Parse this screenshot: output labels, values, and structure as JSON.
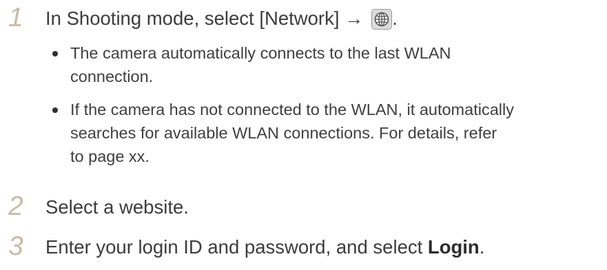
{
  "steps": [
    {
      "number": "1",
      "text_before": "In Shooting mode, select [Network] →",
      "text_after": ".",
      "icon": "globe-icon",
      "bullets": [
        {
          "lines": [
            "The camera automatically connects to the last WLAN",
            "connection."
          ]
        },
        {
          "lines": [
            "If the camera has not connected to the WLAN, it automatically",
            "searches for available WLAN connections. For details, refer",
            "to page xx."
          ]
        }
      ]
    },
    {
      "number": "2",
      "text": "Select a website."
    },
    {
      "number": "3",
      "text_before": "Enter your login ID and password, and select ",
      "bold": "Login",
      "text_after": "."
    }
  ],
  "colors": {
    "step_number": "#c9bba6",
    "text": "#3c3c3c",
    "icon_bg": "#dcdcdc"
  }
}
